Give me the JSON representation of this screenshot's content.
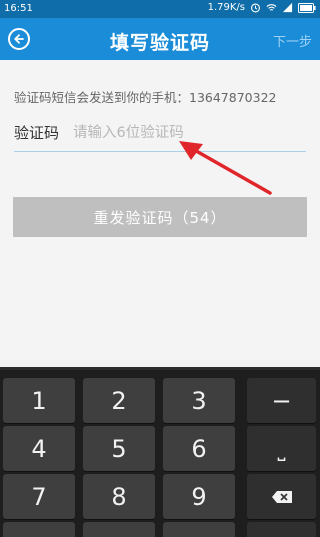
{
  "status_bar": {
    "time": "16:51",
    "speed": "1.79K/s"
  },
  "header": {
    "title": "填写验证码",
    "next_label": "下一步"
  },
  "content": {
    "sent_to_text": "验证码短信会发送到你的手机：13647870322",
    "code_label": "验证码",
    "code_placeholder": "请输入6位验证码",
    "resend_label": "重发验证码（54）"
  },
  "keyboard": {
    "keys": [
      "1",
      "2",
      "3",
      "4",
      "5",
      "6",
      "7",
      "8",
      "9"
    ],
    "side_keys": [
      "−",
      "⎵"
    ]
  },
  "colors": {
    "title_bar": "#1b8cd8",
    "status_bar": "#0f6ea9",
    "button_disabled": "#bfbfbf",
    "annotation_arrow": "#e0262b"
  }
}
